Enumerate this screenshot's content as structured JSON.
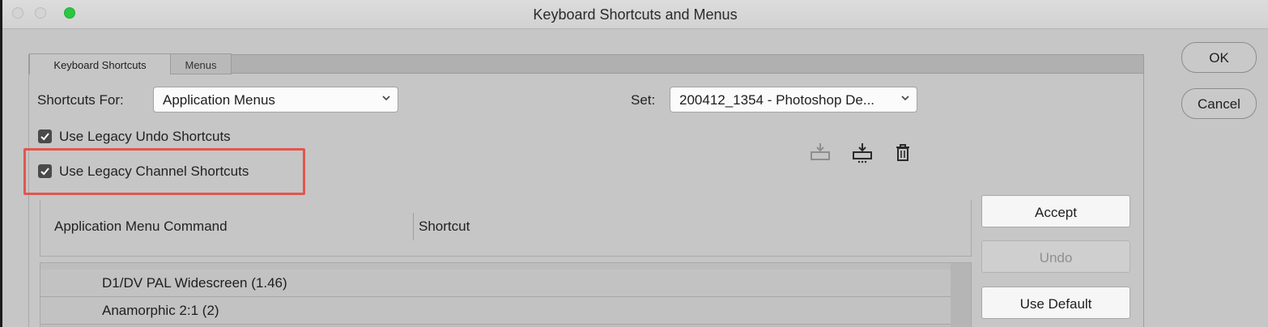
{
  "window": {
    "title": "Keyboard Shortcuts and Menus"
  },
  "tabs": [
    {
      "label": "Keyboard Shortcuts",
      "selected": true
    },
    {
      "label": "Menus",
      "selected": false
    }
  ],
  "shortcuts_for": {
    "label": "Shortcuts For:",
    "value": "Application Menus"
  },
  "set": {
    "label": "Set:",
    "value": "200412_1354 - Photoshop De..."
  },
  "options": [
    {
      "label": "Use Legacy Undo Shortcuts",
      "checked": true
    },
    {
      "label": "Use Legacy Channel Shortcuts",
      "checked": true,
      "highlighted": true
    }
  ],
  "toolbar_icons": [
    "save-set-icon",
    "save-set-as-icon",
    "delete-set-icon"
  ],
  "table": {
    "columns": [
      "Application Menu Command",
      "Shortcut"
    ],
    "rows": [
      {
        "command": "D1/DV PAL Widescreen (1.46)"
      },
      {
        "command": "Anamorphic 2:1 (2)"
      }
    ]
  },
  "side_buttons": {
    "accept": "Accept",
    "undo": "Undo",
    "use_default": "Use Default"
  },
  "dialog_buttons": {
    "ok": "OK",
    "cancel": "Cancel"
  },
  "colors": {
    "highlight": "#e2564e",
    "zoom_button": "#2ac73f"
  }
}
